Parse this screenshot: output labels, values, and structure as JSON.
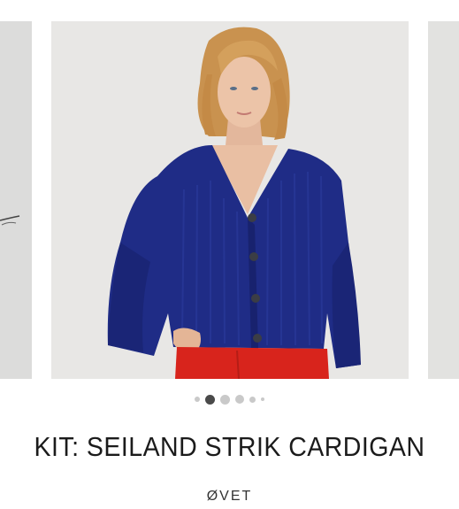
{
  "product": {
    "title": "KIT: SEILAND STRIK CARDIGAN",
    "brand": "ØVET"
  },
  "carousel": {
    "slide_count": 6,
    "active_index": 1,
    "image_subject": "model-wearing-navy-cardigan"
  },
  "colors": {
    "cardigan": "#1f2c86",
    "pants": "#d8241c",
    "background": "#e7e6e4",
    "active_dot": "#4a4a4a",
    "inactive_dot": "#c9c9c9"
  }
}
